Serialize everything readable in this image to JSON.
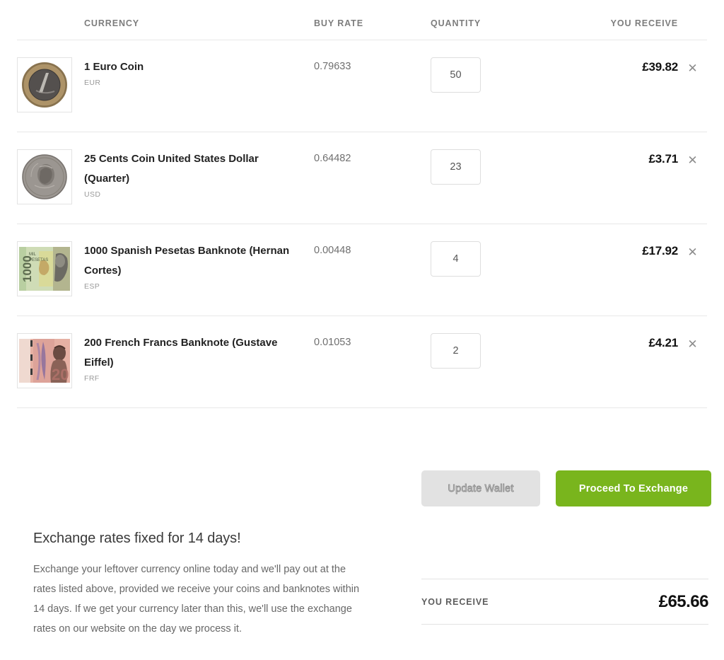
{
  "table": {
    "headers": {
      "currency": "CURRENCY",
      "buy_rate": "BUY RATE",
      "quantity": "QUANTITY",
      "you_receive": "YOU RECEIVE"
    },
    "rows": [
      {
        "name": "1 Euro Coin",
        "code": "EUR",
        "buy_rate": "0.79633",
        "quantity": "50",
        "you_receive": "£39.82",
        "remove_icon": "close-icon",
        "thumbnail": "euro-coin-image"
      },
      {
        "name": "25 Cents Coin United States Dollar (Quarter)",
        "code": "USD",
        "buy_rate": "0.64482",
        "quantity": "23",
        "you_receive": "£3.71",
        "remove_icon": "close-icon",
        "thumbnail": "us-quarter-coin-image"
      },
      {
        "name": "1000 Spanish Pesetas Banknote (Hernan Cortes)",
        "code": "ESP",
        "buy_rate": "0.00448",
        "quantity": "4",
        "you_receive": "£17.92",
        "remove_icon": "close-icon",
        "thumbnail": "spanish-pesetas-banknote-image"
      },
      {
        "name": "200 French Francs Banknote (Gustave Eiffel)",
        "code": "FRF",
        "buy_rate": "0.01053",
        "quantity": "2",
        "you_receive": "£4.21",
        "remove_icon": "close-icon",
        "thumbnail": "french-francs-banknote-image"
      }
    ]
  },
  "actions": {
    "update_wallet_label": "Update Wallet",
    "proceed_label": "Proceed To Exchange",
    "proceed_color": "#79b51d",
    "update_color": "#e2e2e2"
  },
  "info": {
    "heading": "Exchange rates fixed for 14 days!",
    "body": "Exchange your leftover currency online today and we'll pay out at the rates listed above, provided we receive your coins and banknotes within 14 days. If we get your currency later than this, we'll use the exchange rates on our website on the day we process it."
  },
  "totals": {
    "label": "YOU RECEIVE",
    "amount": "£65.66"
  }
}
